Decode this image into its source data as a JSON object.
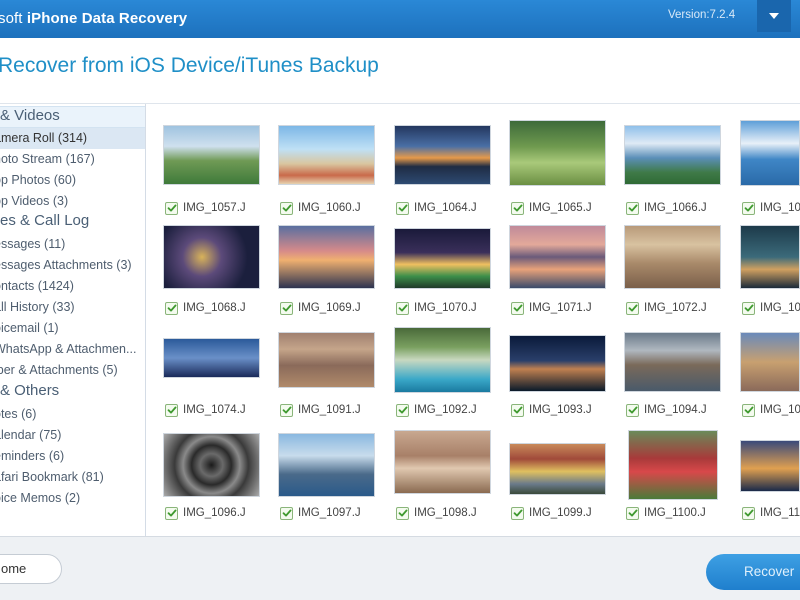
{
  "app": {
    "brand": "soft",
    "product": "iPhone Data Recovery",
    "version": "Version:7.2.4",
    "colors": {
      "titlebar": "#1d71bd",
      "accent": "#1f8fc7",
      "check": "#4aa13a"
    }
  },
  "header": {
    "title": "Recover from iOS Device/iTunes Backup"
  },
  "menu": {
    "icon": "chevron-down-icon"
  },
  "sidebar": {
    "categories": [
      {
        "label": "& Videos",
        "items": [
          {
            "label": "amera Roll (314)",
            "selected": true
          },
          {
            "label": "hoto Stream (167)"
          },
          {
            "label": "pp Photos (60)"
          },
          {
            "label": "pp Videos (3)"
          }
        ]
      },
      {
        "label": "es & Call Log",
        "items": [
          {
            "label": "essages (11)"
          },
          {
            "label": "essages Attachments (3)"
          },
          {
            "label": "ontacts (1424)"
          },
          {
            "label": "all History (33)"
          },
          {
            "label": "oicemail (1)"
          },
          {
            "label": "WhatsApp & Attachmen..."
          },
          {
            "label": "iber & Attachments (5)"
          }
        ]
      },
      {
        "label": "& Others",
        "items": [
          {
            "label": "otes (6)"
          },
          {
            "label": "alendar (75)"
          },
          {
            "label": "eminders (6)"
          },
          {
            "label": "afari Bookmark (81)"
          },
          {
            "label": "oice Memos (2)"
          }
        ]
      }
    ]
  },
  "photos": [
    [
      "IMG_1057.J",
      "IMG_1060.J",
      "IMG_1064.J",
      "IMG_1065.J",
      "IMG_1066.J",
      "IMG_10"
    ],
    [
      "IMG_1068.J",
      "IMG_1069.J",
      "IMG_1070.J",
      "IMG_1071.J",
      "IMG_1072.J",
      "IMG_10"
    ],
    [
      "IMG_1074.J",
      "IMG_1091.J",
      "IMG_1092.J",
      "IMG_1093.J",
      "IMG_1094.J",
      "IMG_10"
    ],
    [
      "IMG_1096.J",
      "IMG_1097.J",
      "IMG_1098.J",
      "IMG_1099.J",
      "IMG_1100.J",
      "IMG_11"
    ]
  ],
  "footer": {
    "home_label": "ome",
    "recover_label": "Recover"
  }
}
